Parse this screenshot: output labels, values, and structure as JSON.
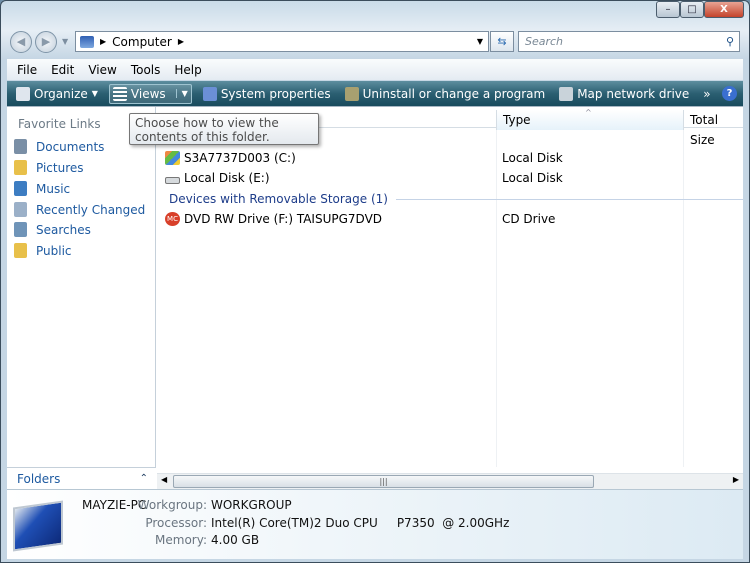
{
  "window": {
    "minimize": "–",
    "maximize": "□",
    "close": "X"
  },
  "address": {
    "path": [
      "Computer"
    ],
    "search_placeholder": "Search"
  },
  "menu": [
    "File",
    "Edit",
    "View",
    "Tools",
    "Help"
  ],
  "toolbar": {
    "organize": "Organize",
    "views": "Views",
    "system_properties": "System properties",
    "uninstall": "Uninstall or change a program",
    "map_drive": "Map network drive",
    "more": "»",
    "help": "?"
  },
  "sidebar": {
    "title": "Favorite Links",
    "items": [
      {
        "label": "Documents",
        "color": "#7a8fa6"
      },
      {
        "label": "Pictures",
        "color": "#e8c04a"
      },
      {
        "label": "Music",
        "color": "#3d7dc2"
      },
      {
        "label": "Recently Changed",
        "color": "#9bb0c8"
      },
      {
        "label": "Searches",
        "color": "#6f94b8"
      },
      {
        "label": "Public",
        "color": "#e8c04a"
      }
    ],
    "folders": "Folders"
  },
  "columns": [
    "Type",
    "Total Size"
  ],
  "tooltip": "Choose how to view the contents of this folder.",
  "items": [
    {
      "name": "S3A7737D003 (C:)",
      "type": "Local Disk"
    },
    {
      "name": "Local Disk (E:)",
      "type": "Local Disk"
    }
  ],
  "group_removable": "Devices with Removable Storage (1)",
  "removable": [
    {
      "name": "DVD RW Drive (F:) TAISUPG7DVD",
      "type": "CD Drive"
    }
  ],
  "details": {
    "computer": "MAYZIE-PC",
    "workgroup_label": "Workgroup:",
    "workgroup": "WORKGROUP",
    "processor_label": "Processor:",
    "processor": "Intel(R) Core(TM)2 Duo CPU     P7350  @ 2.00GHz",
    "memory_label": "Memory:",
    "memory": "4.00 GB"
  }
}
